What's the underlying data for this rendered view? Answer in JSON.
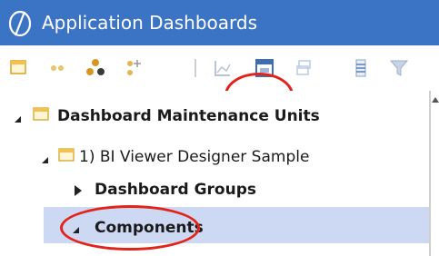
{
  "window": {
    "title": "Application Dashboards",
    "app_icon": "onestream-logo-icon"
  },
  "toolbar": {
    "buttons": [
      {
        "name": "new-maintenance-unit-icon"
      },
      {
        "name": "new-group-icon"
      },
      {
        "name": "manage-groups-icon"
      },
      {
        "name": "add-item-icon"
      },
      {
        "name": "chart-icon"
      },
      {
        "name": "component-icon"
      },
      {
        "name": "copy-icon"
      },
      {
        "name": "dataset-icon"
      },
      {
        "name": "filter-icon"
      }
    ]
  },
  "tree": {
    "root": {
      "label": "Dashboard Maintenance Units",
      "expanded": true
    },
    "child": {
      "label": "1) BI Viewer Designer Sample",
      "expanded": true
    },
    "groups": {
      "label": "Dashboard Groups",
      "expanded": false
    },
    "components": {
      "label": "Components",
      "expanded": true,
      "selected": true
    }
  },
  "annotations": {
    "color": "#e2231a",
    "selection_color": "#cdd9f2",
    "titlebar_color": "#3b74c4"
  }
}
